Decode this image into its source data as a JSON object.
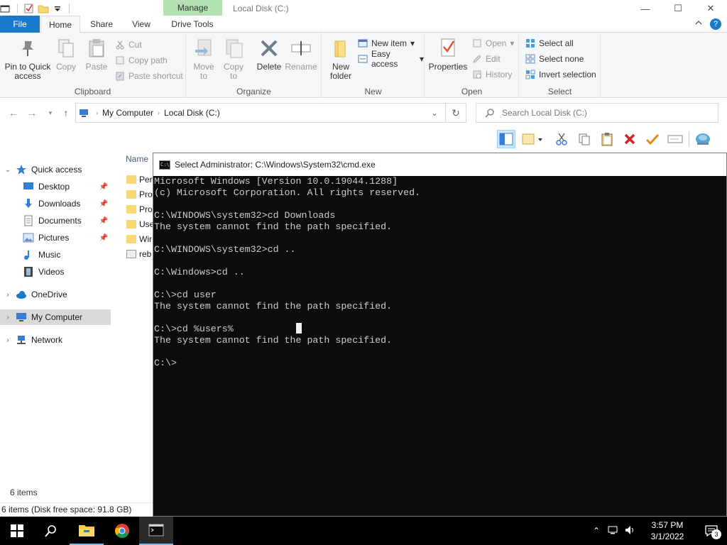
{
  "explorer": {
    "window_title": "Local Disk (C:)",
    "contextual_tab": "Manage",
    "tabs": {
      "file": "File",
      "home": "Home",
      "share": "Share",
      "view": "View",
      "drive_tools": "Drive Tools"
    },
    "window_controls": {
      "minimize": "—",
      "maximize": "☐",
      "close": "✕"
    },
    "help": "?",
    "ribbon": {
      "clipboard": {
        "label": "Clipboard",
        "pin": "Pin to Quick access",
        "copy": "Copy",
        "paste": "Paste",
        "cut": "Cut",
        "copy_path": "Copy path",
        "paste_shortcut": "Paste shortcut"
      },
      "organize": {
        "label": "Organize",
        "move_to": "Move to",
        "copy_to": "Copy to",
        "delete": "Delete",
        "rename": "Rename"
      },
      "new": {
        "label": "New",
        "new_folder": "New folder",
        "new_item": "New item",
        "easy_access": "Easy access"
      },
      "open": {
        "label": "Open",
        "properties": "Properties",
        "open": "Open",
        "edit": "Edit",
        "history": "History"
      },
      "select": {
        "label": "Select",
        "select_all": "Select all",
        "select_none": "Select none",
        "invert": "Invert selection"
      }
    },
    "address": {
      "path": [
        "My Computer",
        "Local Disk (C:)"
      ],
      "search_placeholder": "Search Local Disk (C:)"
    },
    "nav": {
      "quick_access": "Quick access",
      "desktop": "Desktop",
      "downloads": "Downloads",
      "documents": "Documents",
      "pictures": "Pictures",
      "music": "Music",
      "videos": "Videos",
      "onedrive": "OneDrive",
      "my_computer": "My Computer",
      "network": "Network"
    },
    "content": {
      "name_header": "Name",
      "files": [
        "Per",
        "Pro",
        "Pro",
        "Use",
        "Wir",
        "reb"
      ]
    },
    "status": {
      "items": "6 items",
      "disk": "6 items (Disk free space: 91.8 GB)"
    }
  },
  "cmd": {
    "title": "Select Administrator: C:\\Windows\\System32\\cmd.exe",
    "icon_text": "C:\\",
    "lines": [
      "Microsoft Windows [Version 10.0.19044.1288]",
      "(c) Microsoft Corporation. All rights reserved.",
      "",
      "C:\\WINDOWS\\system32>cd Downloads",
      "The system cannot find the path specified.",
      "",
      "C:\\WINDOWS\\system32>cd ..",
      "",
      "C:\\Windows>cd ..",
      "",
      "C:\\>cd user",
      "The system cannot find the path specified.",
      "",
      "C:\\>cd %users%",
      "The system cannot find the path specified.",
      "",
      "C:\\>"
    ]
  },
  "taskbar": {
    "time": "3:57 PM",
    "date": "3/1/2022",
    "notification_count": "3",
    "colors": {
      "accent": "#76b9ed",
      "background": "#000000"
    }
  }
}
